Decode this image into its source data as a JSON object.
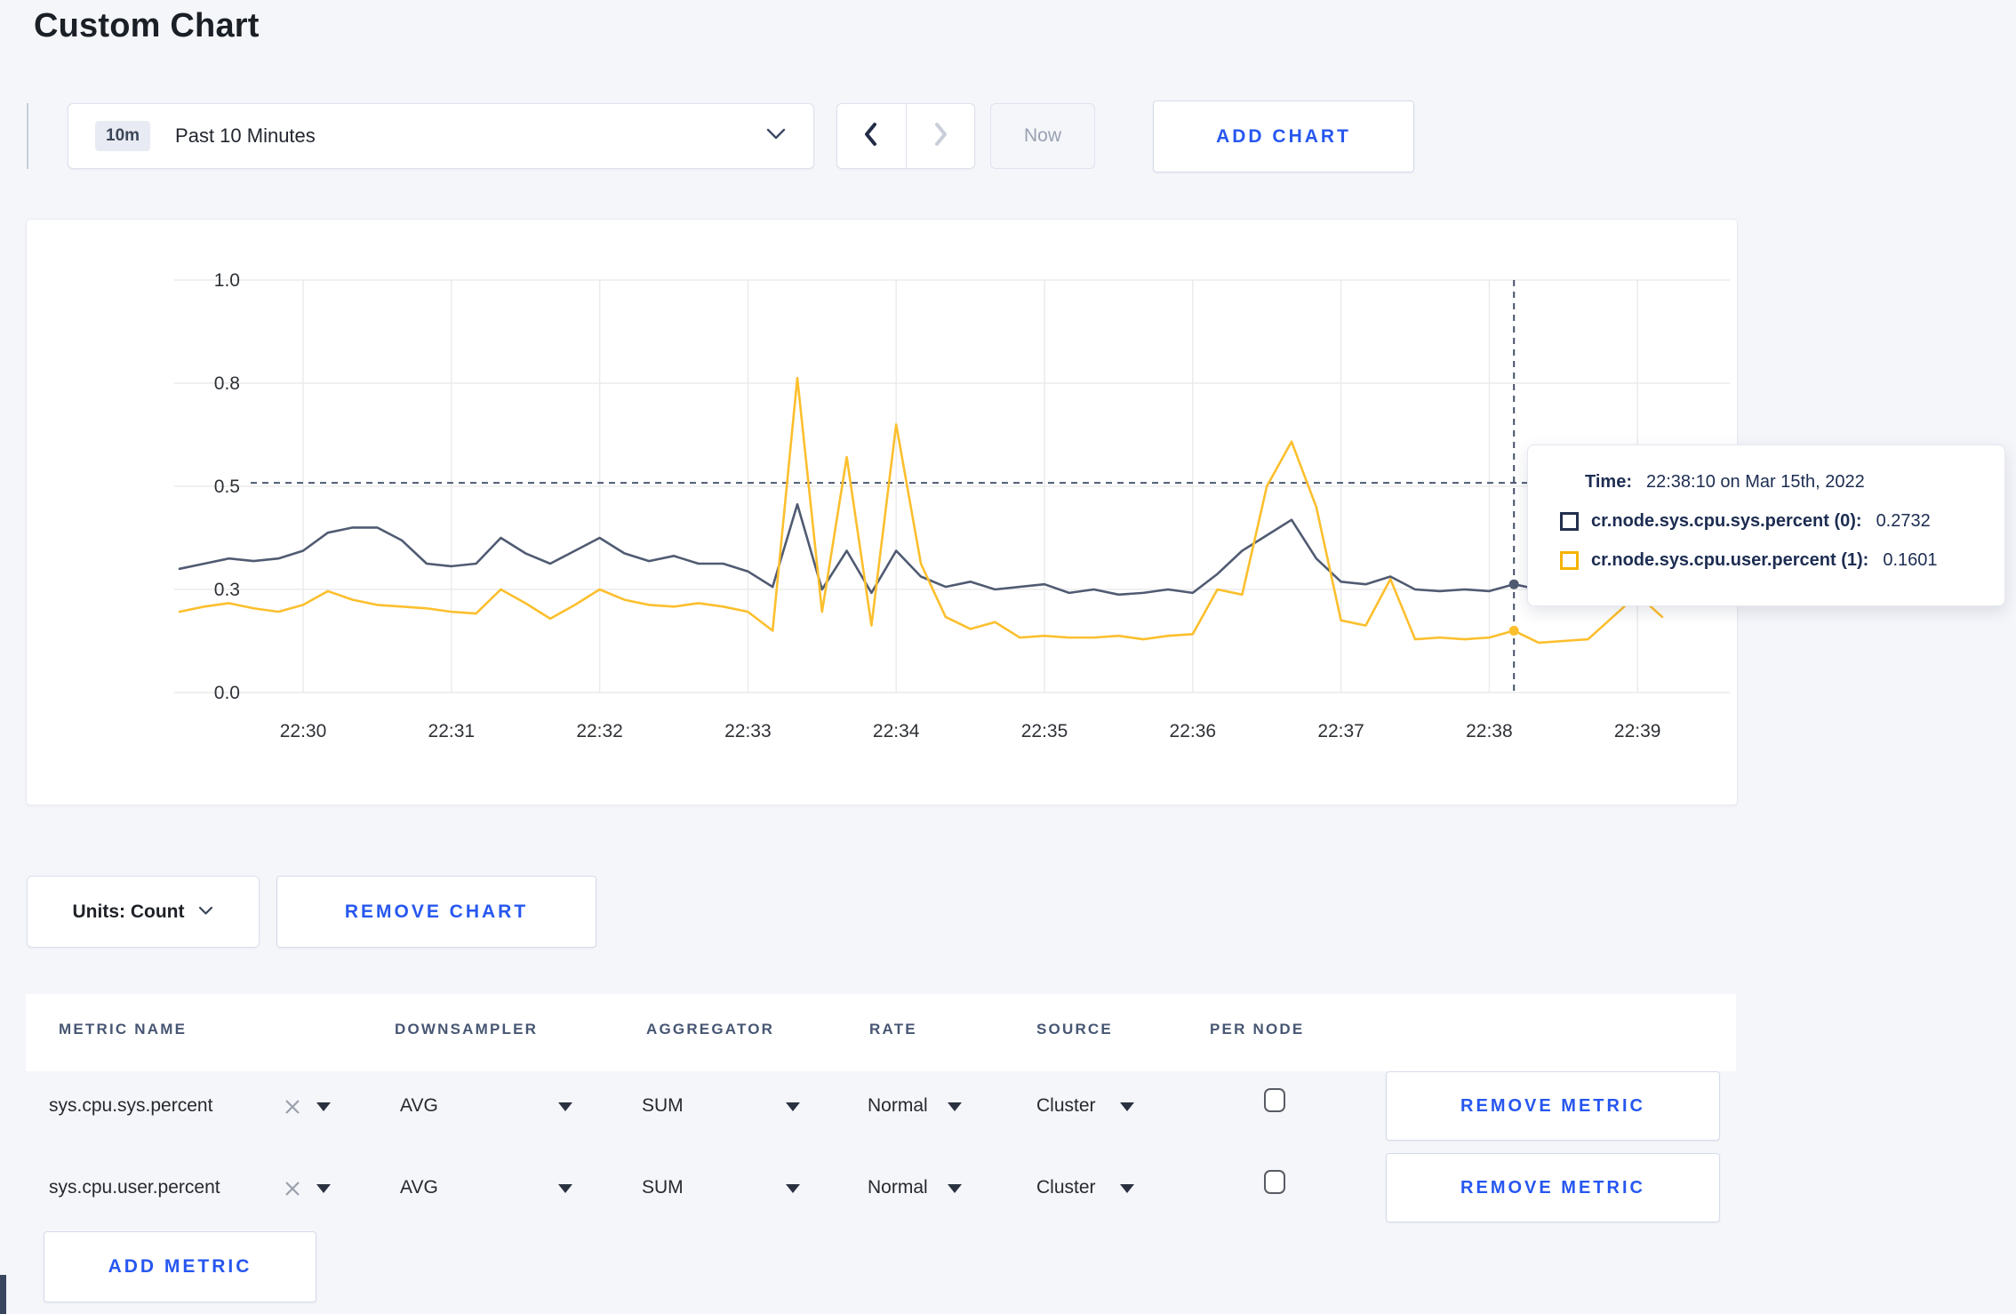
{
  "page": {
    "title": "Custom Chart",
    "background": "#f5f6fa",
    "accent_blue": "#2757f0"
  },
  "toolbar": {
    "time_badge": "10m",
    "time_label": "Past 10 Minutes",
    "now_label": "Now",
    "add_chart_label": "ADD CHART"
  },
  "chart_data": {
    "type": "line",
    "title": "",
    "xlabel": "",
    "ylabel": "",
    "ylim": [
      0,
      1
    ],
    "grid": true,
    "x_start_time": "22:29:10",
    "x_step_seconds": 10,
    "x_ticks": [
      "22:30",
      "22:31",
      "22:32",
      "22:33",
      "22:34",
      "22:35",
      "22:36",
      "22:37",
      "22:38",
      "22:39"
    ],
    "y_ticks": [
      {
        "value": 0.0,
        "label": "0.0"
      },
      {
        "value": 0.3,
        "label": "0.3"
      },
      {
        "value": 0.5,
        "label": "0.5"
      },
      {
        "value": 0.8,
        "label": "0.8"
      },
      {
        "value": 1.0,
        "label": "1.0"
      }
    ],
    "threshold_value": 0.51,
    "threshold_color": "#4d5a74",
    "crosshair_time": "22:38:10",
    "hover_index": 54,
    "series": [
      {
        "name": "cr.node.sys.cpu.sys.percent",
        "color": "#505b72",
        "values": [
          0.34,
          0.35,
          0.36,
          0.355,
          0.36,
          0.375,
          0.41,
          0.42,
          0.42,
          0.395,
          0.35,
          0.345,
          0.35,
          0.4,
          0.37,
          0.35,
          0.375,
          0.4,
          0.37,
          0.355,
          0.365,
          0.35,
          0.35,
          0.335,
          0.305,
          0.465,
          0.3,
          0.375,
          0.29,
          0.375,
          0.325,
          0.305,
          0.315,
          0.3,
          0.305,
          0.31,
          0.29,
          0.3,
          0.285,
          0.29,
          0.3,
          0.29,
          0.33,
          0.375,
          0.405,
          0.435,
          0.36,
          0.315,
          0.31,
          0.325,
          0.3,
          0.295,
          0.3,
          0.295,
          0.31,
          0.3,
          0.315,
          0.3,
          0.3,
          0.31,
          0.3
        ]
      },
      {
        "name": "cr.node.sys.cpu.user.percent",
        "color": "#fcbf2d",
        "values": [
          0.235,
          0.25,
          0.26,
          0.245,
          0.235,
          0.255,
          0.295,
          0.27,
          0.255,
          0.25,
          0.245,
          0.235,
          0.23,
          0.3,
          0.26,
          0.215,
          0.255,
          0.3,
          0.27,
          0.255,
          0.25,
          0.26,
          0.25,
          0.235,
          0.18,
          0.81,
          0.235,
          0.585,
          0.195,
          0.68,
          0.35,
          0.22,
          0.185,
          0.205,
          0.16,
          0.165,
          0.16,
          0.16,
          0.165,
          0.155,
          0.165,
          0.17,
          0.3,
          0.285,
          0.5,
          0.63,
          0.46,
          0.21,
          0.195,
          0.32,
          0.155,
          0.16,
          0.155,
          0.16,
          0.18,
          0.145,
          0.15,
          0.155,
          0.22,
          0.285,
          0.22
        ]
      }
    ]
  },
  "tooltip": {
    "time_label": "Time:",
    "time_value": "22:38:10 on Mar 15th, 2022",
    "rows": [
      {
        "label": "cr.node.sys.cpu.sys.percent (0):",
        "value": "0.2732",
        "color": "#222f4e"
      },
      {
        "label": "cr.node.sys.cpu.user.percent (1):",
        "value": "0.1601",
        "color": "#f5b300"
      }
    ]
  },
  "units": {
    "label": "Units: Count"
  },
  "remove_chart_label": "REMOVE CHART",
  "metrics_table": {
    "headers": [
      "METRIC NAME",
      "DOWNSAMPLER",
      "AGGREGATOR",
      "RATE",
      "SOURCE",
      "PER NODE"
    ],
    "rows": [
      {
        "metric": "sys.cpu.sys.percent",
        "downsampler": "AVG",
        "aggregator": "SUM",
        "rate": "Normal",
        "source": "Cluster",
        "per_node_checked": false,
        "remove_label": "REMOVE METRIC"
      },
      {
        "metric": "sys.cpu.user.percent",
        "downsampler": "AVG",
        "aggregator": "SUM",
        "rate": "Normal",
        "source": "Cluster",
        "per_node_checked": false,
        "remove_label": "REMOVE METRIC"
      }
    ],
    "add_metric_label": "ADD METRIC"
  }
}
